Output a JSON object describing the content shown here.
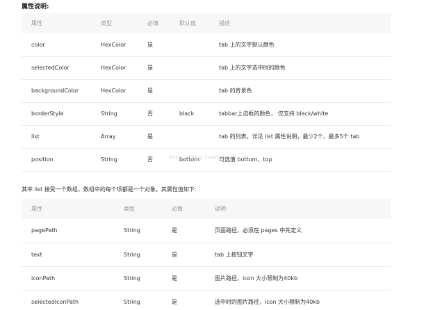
{
  "title": "属性说明:",
  "tab_table": {
    "headers": [
      "属性",
      "类型",
      "必填",
      "默认值",
      "描述"
    ],
    "rows": [
      [
        "color",
        "HexColor",
        "是",
        "",
        "tab 上的文字默认颜色"
      ],
      [
        "selectedColor",
        "HexColor",
        "是",
        "",
        "tab 上的文字选中时的颜色"
      ],
      [
        "backgroundColor",
        "HexColor",
        "是",
        "",
        "tab 的背景色"
      ],
      [
        "borderStyle",
        "String",
        "否",
        "black",
        "tabbar上边框的颜色， 仅支持 black/white"
      ],
      [
        "list",
        "Array",
        "是",
        "",
        "tab 的列表，详见 list 属性说明，最少2个、最多5个 tab"
      ],
      [
        "position",
        "String",
        "否",
        "bottom",
        "可选值 bottom、top"
      ]
    ]
  },
  "list_intro": "其中 list 接受一个数组，数组中的每个项都是一个对象，其属性值如下:",
  "list_table": {
    "headers": [
      "属性",
      "类型",
      "必填",
      "说明"
    ],
    "rows": [
      [
        "pagePath",
        "String",
        "是",
        "页面路径，必须在 pages 中先定义"
      ],
      [
        "text",
        "String",
        "是",
        "tab 上按钮文字"
      ],
      [
        "iconPath",
        "String",
        "是",
        "图片路径，icon 大小限制为40kb"
      ],
      [
        "selectedIconPath",
        "String",
        "是",
        "选中时的图片路径，icon 大小限制为40kb"
      ]
    ]
  },
  "watermark": "http://blog.csdn.n"
}
